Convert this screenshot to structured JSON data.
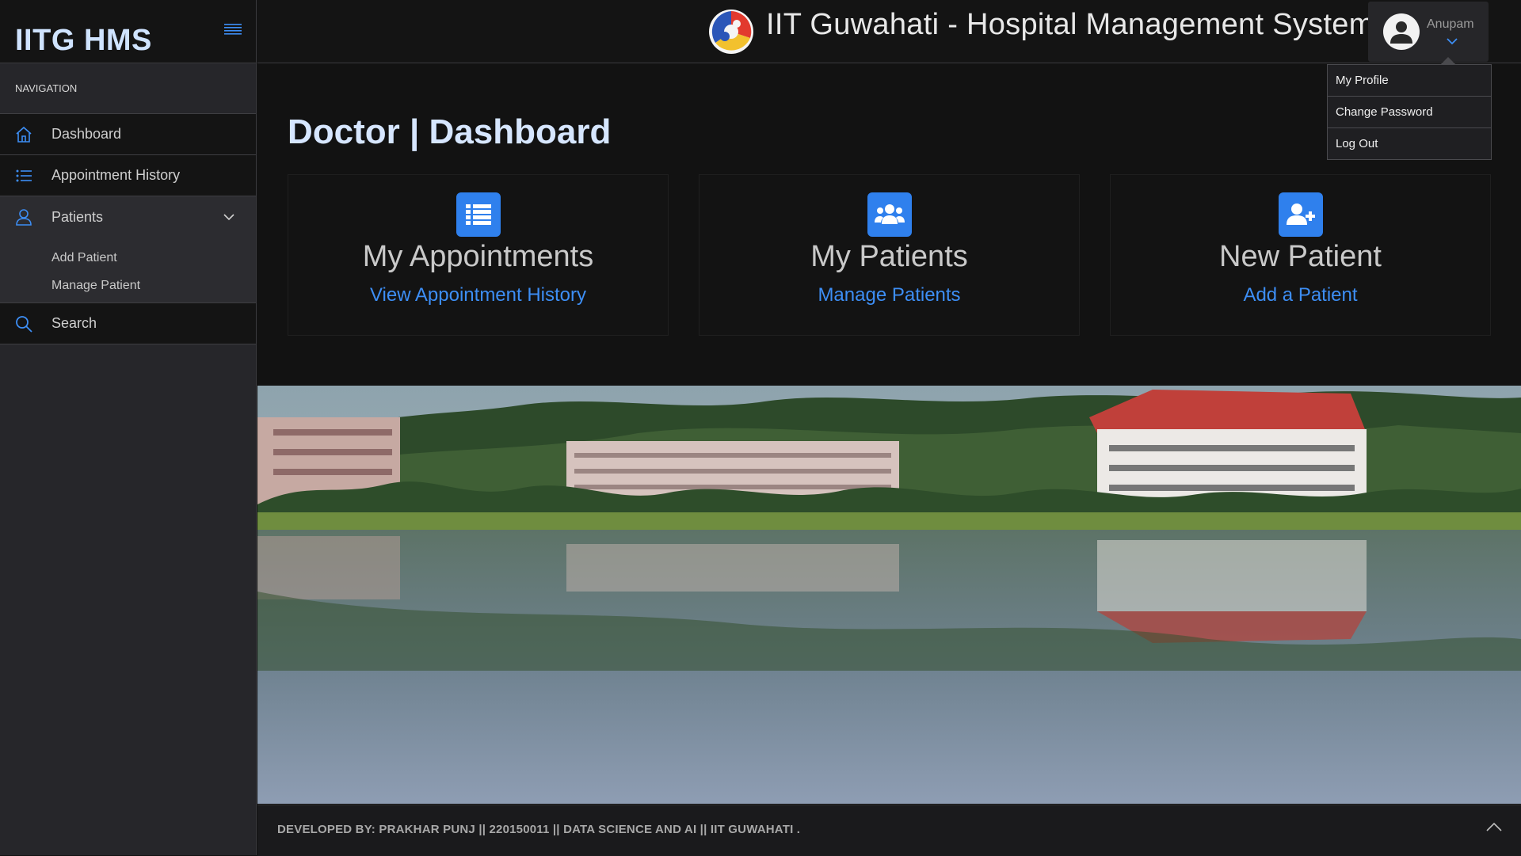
{
  "sidebar": {
    "brand": "IITG HMS",
    "nav_heading": "NAVIGATION",
    "items": [
      {
        "label": "Dashboard",
        "icon": "home-icon"
      },
      {
        "label": "Appointment History",
        "icon": "list-icon"
      },
      {
        "label": "Patients",
        "icon": "user-icon",
        "expanded": true,
        "children": [
          {
            "label": "Add Patient"
          },
          {
            "label": "Manage Patient"
          }
        ]
      },
      {
        "label": "Search",
        "icon": "search-icon"
      }
    ]
  },
  "header": {
    "title": "IIT Guwahati - Hospital Management System",
    "user_name": "Anupam"
  },
  "user_menu": {
    "items": [
      "My Profile",
      "Change Password",
      "Log Out"
    ]
  },
  "main": {
    "page_title": "Doctor | Dashboard",
    "cards": [
      {
        "title": "My Appointments",
        "link": "View Appointment History",
        "icon": "list-icon"
      },
      {
        "title": "My Patients",
        "link": "Manage Patients",
        "icon": "users-icon"
      },
      {
        "title": "New Patient",
        "link": "Add a Patient",
        "icon": "user-plus-icon"
      }
    ]
  },
  "footer": {
    "text": "DEVELOPED BY: PRAKHAR PUNJ || 220150011 || DATA SCIENCE AND AI || IIT GUWAHATI ."
  },
  "colors": {
    "accent": "#2f80ed",
    "link": "#3d8ef5",
    "brand_text": "#cfe3ff",
    "background": "#121212",
    "sidebar": "#26262a"
  }
}
